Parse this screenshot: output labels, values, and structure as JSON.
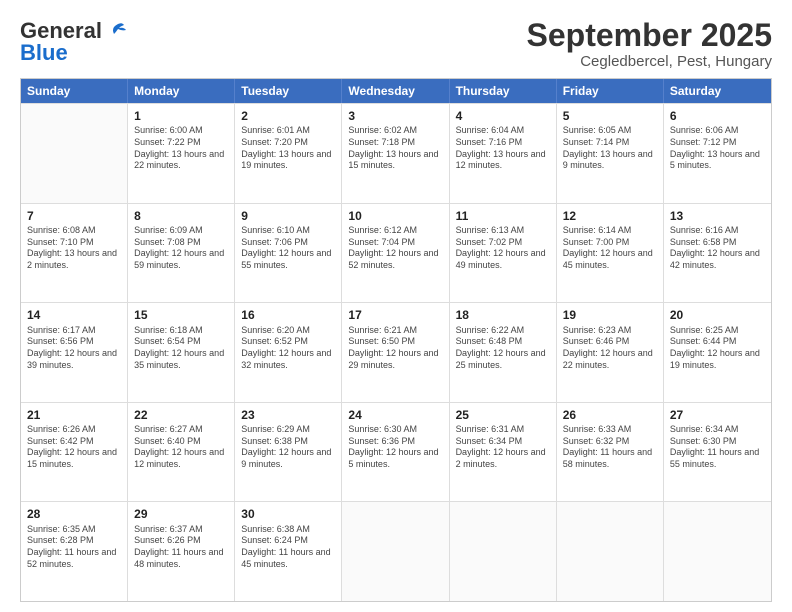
{
  "logo": {
    "general": "General",
    "blue": "Blue"
  },
  "title": "September 2025",
  "subtitle": "Cegledbercel, Pest, Hungary",
  "weekdays": [
    "Sunday",
    "Monday",
    "Tuesday",
    "Wednesday",
    "Thursday",
    "Friday",
    "Saturday"
  ],
  "rows": [
    [
      {
        "day": "",
        "empty": true
      },
      {
        "day": "1",
        "sunrise": "6:00 AM",
        "sunset": "7:22 PM",
        "daylight": "13 hours and 22 minutes."
      },
      {
        "day": "2",
        "sunrise": "6:01 AM",
        "sunset": "7:20 PM",
        "daylight": "13 hours and 19 minutes."
      },
      {
        "day": "3",
        "sunrise": "6:02 AM",
        "sunset": "7:18 PM",
        "daylight": "13 hours and 15 minutes."
      },
      {
        "day": "4",
        "sunrise": "6:04 AM",
        "sunset": "7:16 PM",
        "daylight": "13 hours and 12 minutes."
      },
      {
        "day": "5",
        "sunrise": "6:05 AM",
        "sunset": "7:14 PM",
        "daylight": "13 hours and 9 minutes."
      },
      {
        "day": "6",
        "sunrise": "6:06 AM",
        "sunset": "7:12 PM",
        "daylight": "13 hours and 5 minutes."
      }
    ],
    [
      {
        "day": "7",
        "sunrise": "6:08 AM",
        "sunset": "7:10 PM",
        "daylight": "13 hours and 2 minutes."
      },
      {
        "day": "8",
        "sunrise": "6:09 AM",
        "sunset": "7:08 PM",
        "daylight": "12 hours and 59 minutes."
      },
      {
        "day": "9",
        "sunrise": "6:10 AM",
        "sunset": "7:06 PM",
        "daylight": "12 hours and 55 minutes."
      },
      {
        "day": "10",
        "sunrise": "6:12 AM",
        "sunset": "7:04 PM",
        "daylight": "12 hours and 52 minutes."
      },
      {
        "day": "11",
        "sunrise": "6:13 AM",
        "sunset": "7:02 PM",
        "daylight": "12 hours and 49 minutes."
      },
      {
        "day": "12",
        "sunrise": "6:14 AM",
        "sunset": "7:00 PM",
        "daylight": "12 hours and 45 minutes."
      },
      {
        "day": "13",
        "sunrise": "6:16 AM",
        "sunset": "6:58 PM",
        "daylight": "12 hours and 42 minutes."
      }
    ],
    [
      {
        "day": "14",
        "sunrise": "6:17 AM",
        "sunset": "6:56 PM",
        "daylight": "12 hours and 39 minutes."
      },
      {
        "day": "15",
        "sunrise": "6:18 AM",
        "sunset": "6:54 PM",
        "daylight": "12 hours and 35 minutes."
      },
      {
        "day": "16",
        "sunrise": "6:20 AM",
        "sunset": "6:52 PM",
        "daylight": "12 hours and 32 minutes."
      },
      {
        "day": "17",
        "sunrise": "6:21 AM",
        "sunset": "6:50 PM",
        "daylight": "12 hours and 29 minutes."
      },
      {
        "day": "18",
        "sunrise": "6:22 AM",
        "sunset": "6:48 PM",
        "daylight": "12 hours and 25 minutes."
      },
      {
        "day": "19",
        "sunrise": "6:23 AM",
        "sunset": "6:46 PM",
        "daylight": "12 hours and 22 minutes."
      },
      {
        "day": "20",
        "sunrise": "6:25 AM",
        "sunset": "6:44 PM",
        "daylight": "12 hours and 19 minutes."
      }
    ],
    [
      {
        "day": "21",
        "sunrise": "6:26 AM",
        "sunset": "6:42 PM",
        "daylight": "12 hours and 15 minutes."
      },
      {
        "day": "22",
        "sunrise": "6:27 AM",
        "sunset": "6:40 PM",
        "daylight": "12 hours and 12 minutes."
      },
      {
        "day": "23",
        "sunrise": "6:29 AM",
        "sunset": "6:38 PM",
        "daylight": "12 hours and 9 minutes."
      },
      {
        "day": "24",
        "sunrise": "6:30 AM",
        "sunset": "6:36 PM",
        "daylight": "12 hours and 5 minutes."
      },
      {
        "day": "25",
        "sunrise": "6:31 AM",
        "sunset": "6:34 PM",
        "daylight": "12 hours and 2 minutes."
      },
      {
        "day": "26",
        "sunrise": "6:33 AM",
        "sunset": "6:32 PM",
        "daylight": "11 hours and 58 minutes."
      },
      {
        "day": "27",
        "sunrise": "6:34 AM",
        "sunset": "6:30 PM",
        "daylight": "11 hours and 55 minutes."
      }
    ],
    [
      {
        "day": "28",
        "sunrise": "6:35 AM",
        "sunset": "6:28 PM",
        "daylight": "11 hours and 52 minutes."
      },
      {
        "day": "29",
        "sunrise": "6:37 AM",
        "sunset": "6:26 PM",
        "daylight": "11 hours and 48 minutes."
      },
      {
        "day": "30",
        "sunrise": "6:38 AM",
        "sunset": "6:24 PM",
        "daylight": "11 hours and 45 minutes."
      },
      {
        "day": "",
        "empty": true
      },
      {
        "day": "",
        "empty": true
      },
      {
        "day": "",
        "empty": true
      },
      {
        "day": "",
        "empty": true
      }
    ]
  ]
}
